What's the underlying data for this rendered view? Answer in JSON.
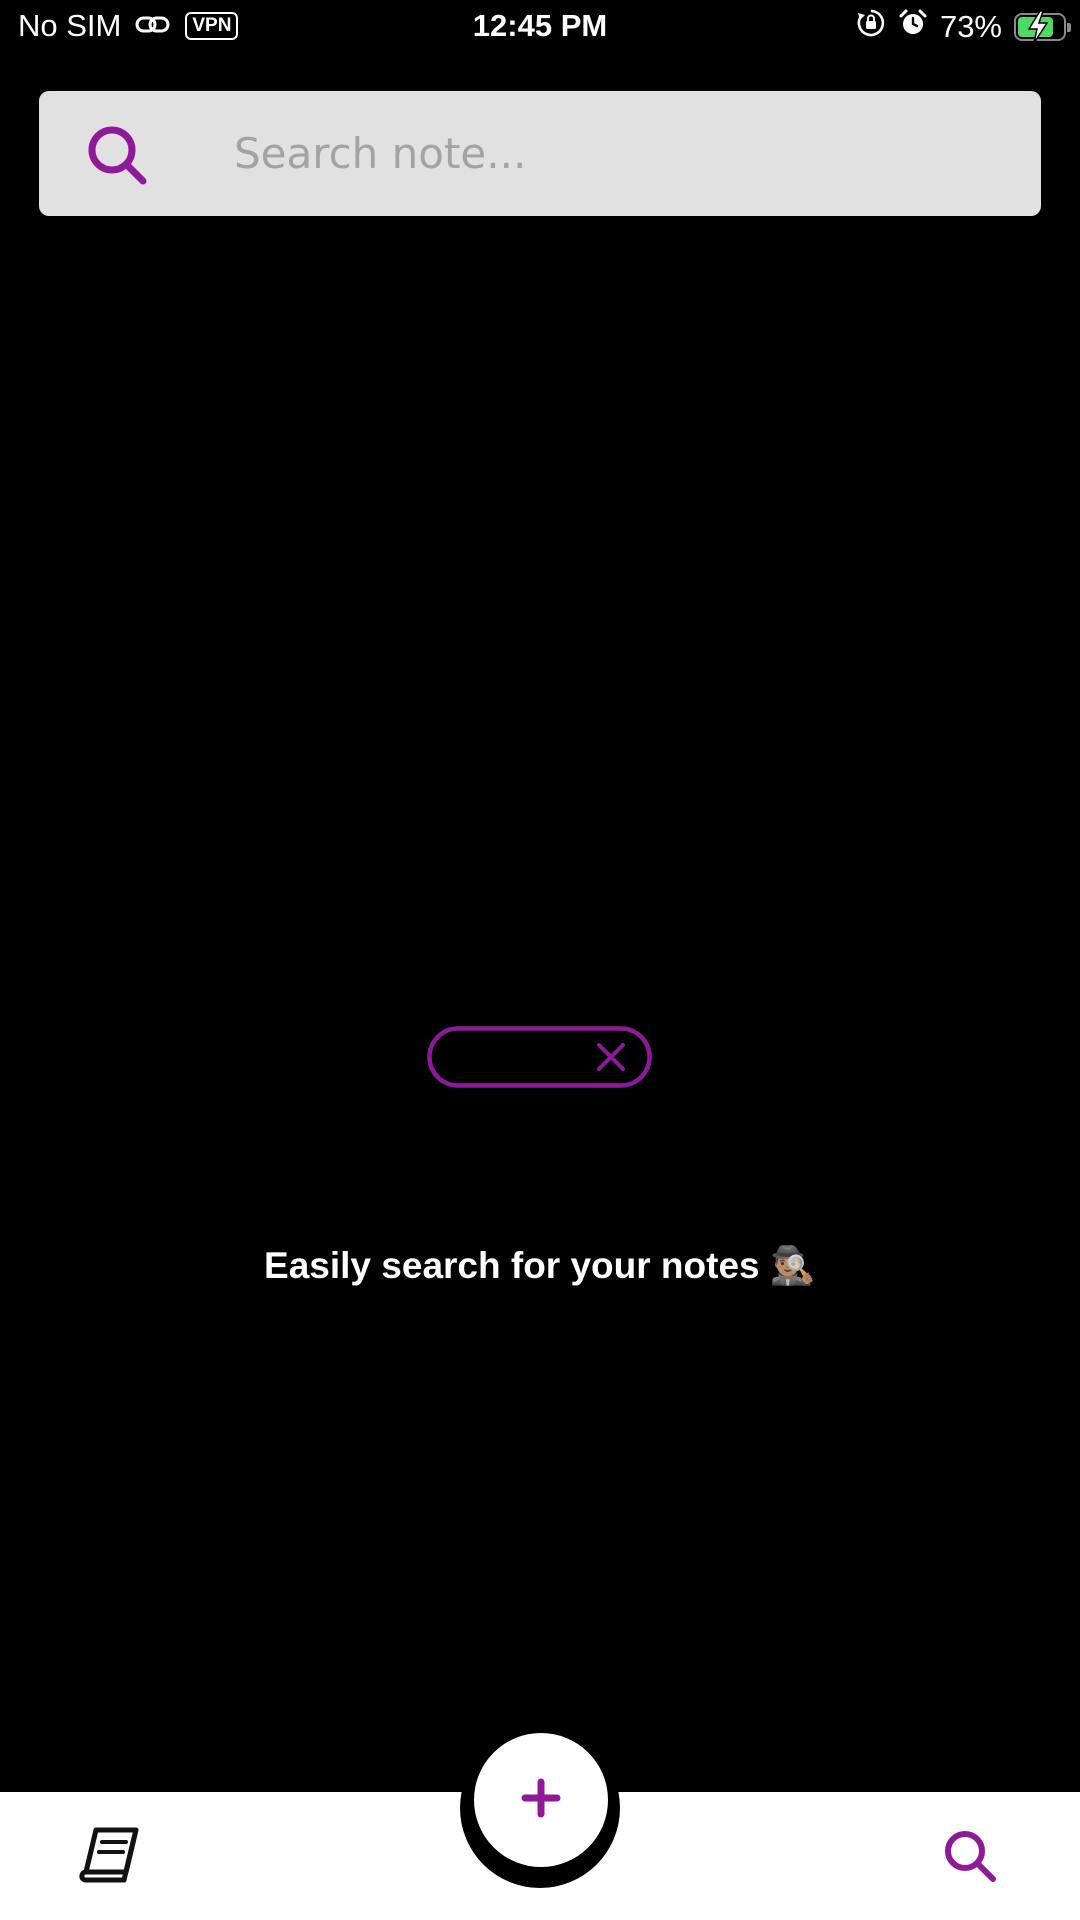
{
  "status_bar": {
    "carrier": "No SIM",
    "vpn": "VPN",
    "time": "12:45 PM",
    "battery_percent": "73%",
    "battery_level": 0.73,
    "icons": [
      "link-icon",
      "orientation-lock-icon",
      "alarm-icon",
      "battery-charging-icon"
    ]
  },
  "search": {
    "placeholder": "Search note...",
    "value": "",
    "icon": "search-icon"
  },
  "empty_state": {
    "illustration": "search-bar-with-x-illustration",
    "message": "Easily search for your notes 🕵🏽‍♂️"
  },
  "bottom_nav": {
    "left_icon": "notebook-icon",
    "center_icon": "plus-icon",
    "right_icon": "search-icon"
  },
  "colors": {
    "accent": "#8e1a9a",
    "background": "#000000",
    "search_bg": "#e1e1e1",
    "placeholder": "#a3a3a3",
    "nav_bg": "#ffffff",
    "battery_fill": "#4cd964"
  }
}
